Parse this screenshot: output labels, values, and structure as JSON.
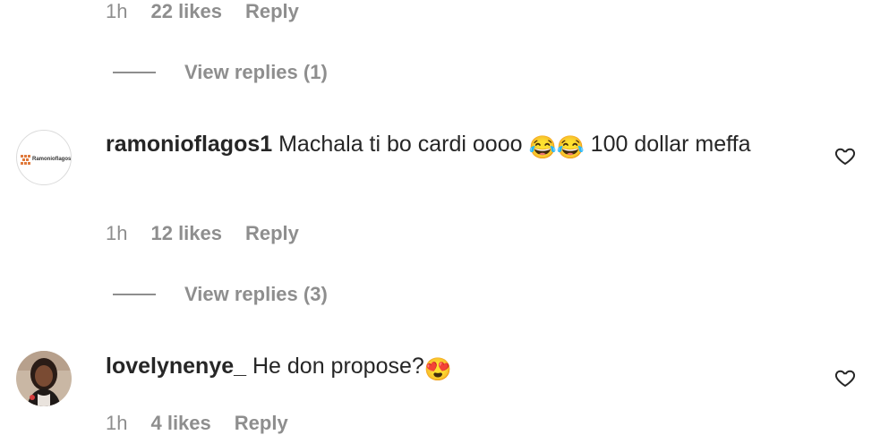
{
  "comments": [
    {
      "time": "1h",
      "likes": "22 likes",
      "reply": "Reply",
      "view_replies": "View replies (1)"
    },
    {
      "username": "ramonioflagos1",
      "text": "Machala ti bo cardi oooo",
      "emoji": "😂😂",
      "text_after": "100 dollar meffa",
      "avatar_logo_text": "Ramonioflagos",
      "time": "1h",
      "likes": "12 likes",
      "reply": "Reply",
      "view_replies": "View replies (3)"
    },
    {
      "username": "lovelynenye_",
      "text": "He don propose?",
      "emoji": "😍",
      "time": "1h",
      "likes": "4 likes",
      "reply": "Reply"
    }
  ],
  "icons": {
    "like": "heart-outline-icon"
  },
  "colors": {
    "text": "#262626",
    "secondary": "#8e8e8e",
    "background": "#ffffff"
  }
}
